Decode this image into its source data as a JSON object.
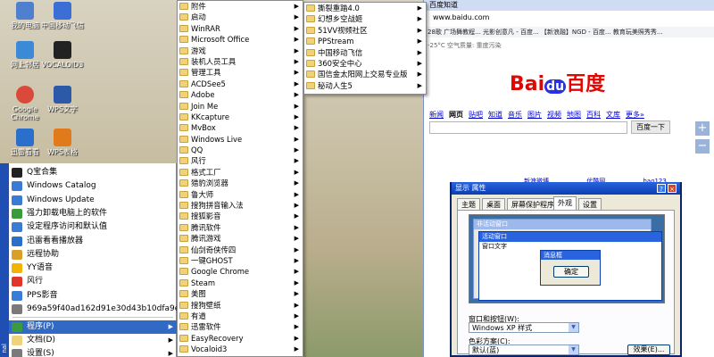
{
  "desktop_icons": [
    {
      "label": "我的电脑",
      "name": "my-computer-icon",
      "color": "#4f7fcf"
    },
    {
      "label": "中国移动飞信",
      "name": "fetion-icon",
      "color": "#3b6fd6"
    },
    {
      "label": "网上邻居",
      "name": "network-places-icon",
      "color": "#3a8ad8"
    },
    {
      "label": "VOCALOID3",
      "name": "vocaloid-icon",
      "color": "#222222"
    },
    {
      "label": "Google Chrome",
      "name": "chrome-icon",
      "color": "#d94a3a"
    },
    {
      "label": "WPS文字",
      "name": "wps-writer-icon",
      "color": "#2d5aa8"
    },
    {
      "label": "迅雷看看",
      "name": "xunlei-kankan-icon",
      "color": "#2a6fcb"
    },
    {
      "label": "WPS表格",
      "name": "wps-sheet-icon",
      "color": "#e07a1b"
    }
  ],
  "start_menu": {
    "strip_text": "nal",
    "pinned": [
      {
        "label": "Q宝合集",
        "color": "#222222"
      },
      {
        "label": "Windows Catalog",
        "color": "#3a7bd5"
      },
      {
        "label": "Windows Update",
        "color": "#3a7bd5"
      },
      {
        "label": "强力卸载电脑上的软件",
        "color": "#3b9a3b"
      },
      {
        "label": "设定程序访问和默认值",
        "color": "#3a7bd5"
      },
      {
        "label": "迅雷看看播放器",
        "color": "#2a6fcb"
      },
      {
        "label": "远程协助",
        "color": "#d8a02a"
      },
      {
        "label": "YY语音",
        "color": "#f2b400"
      },
      {
        "label": "风行",
        "color": "#e0352b"
      },
      {
        "label": "PPS影音",
        "color": "#3a7bd5"
      },
      {
        "label": "969a59f40ad162d91e30d43b10dfa9ec8b13cd4a",
        "color": "#7a7a7a"
      }
    ],
    "bottom": [
      {
        "label": "程序(P)",
        "color": "#3b9a3b",
        "selected": true
      },
      {
        "label": "文档(D)",
        "color": "#f0d27a",
        "selected": false
      },
      {
        "label": "设置(S)",
        "color": "#7a7a7a",
        "selected": false
      }
    ]
  },
  "programs_menu": [
    "附件",
    "启动",
    "WinRAR",
    "Microsoft Office",
    "游戏",
    "装机人员工具",
    "管理工具",
    "ACDSee5",
    "Adobe",
    "Join Me",
    "KKcapture",
    "MvBox",
    "Windows Live",
    "QQ",
    "风行",
    "格式工厂",
    "猎豹浏览器",
    "鲁大师",
    "搜狗拼音输入法",
    "搜狐影音",
    "腾讯软件",
    "腾讯游戏",
    "仙剑奇侠传四",
    "一键GHOST",
    "Google Chrome",
    "Steam",
    "美图",
    "搜狗壁纸",
    "有道",
    "迅雷软件",
    "EasyRecovery",
    "Vocaloid3"
  ],
  "games_submenu": [
    "撕裂重踏4.0",
    "幻想乡空战姬",
    "51VV视频社区",
    "PPStream",
    "中国移动飞信",
    "360安全中心",
    "国信金太阳网上交易专业版",
    "秘动人生5"
  ],
  "browser": {
    "tab_title": "百度知道",
    "url": "www.baidu.com",
    "bookmarks": "28歌 广场舞教程...  光影创意凡 - 百度...  【新浪融】NGD - 百度...  教育玩美照秀秀...",
    "status": "-25°C  空气质量: 重度污染",
    "logo_bai": "Bai",
    "logo_du": "du",
    "logo_cn": "百度",
    "nav": [
      "新闻",
      "网页",
      "贴吧",
      "知道",
      "音乐",
      "图片",
      "视频",
      "地图",
      "百科",
      "文库",
      "更多»"
    ],
    "search_button": "百度一下",
    "links_row": [
      "新浪微博",
      "优酷网",
      "hao123"
    ],
    "colors": {
      "blue": "#2932e1",
      "red": "#e10602"
    }
  },
  "dialog": {
    "title": "显示 属性",
    "tabs": [
      "主题",
      "桌面",
      "屏幕保护程序",
      "外观",
      "设置"
    ],
    "active_tab_index": 3,
    "preview_inactive": "非活动窗口",
    "preview_active": "活动窗口",
    "preview_text": "窗口文字",
    "msgbox_title": "消息框",
    "msgbox_ok": "确定",
    "windows_buttons_label": "窗口和按钮(W):",
    "windows_buttons_value": "Windows XP 样式",
    "color_scheme_label": "色彩方案(C):",
    "color_scheme_value": "默认(蓝)",
    "effects_button": "效果(E)..."
  }
}
